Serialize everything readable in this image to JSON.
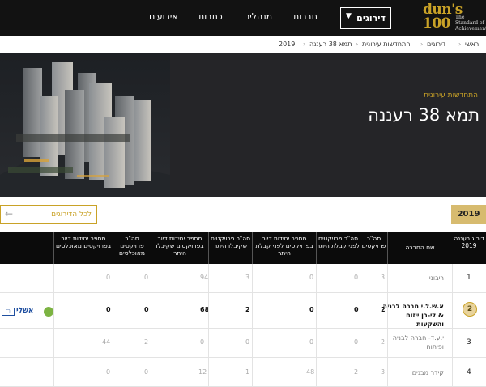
{
  "header": {
    "logo": {
      "main": "dun's 100",
      "tagline": "The Standard of Achievement"
    },
    "nav_dropdown": "דירוגים",
    "nav": [
      "חברות",
      "מנהלים",
      "כתבות",
      "אירועים"
    ]
  },
  "breadcrumb": [
    "ראשי",
    "דירוגים",
    "התחדשות עירונית",
    "תמא 38 רעננה",
    "2019"
  ],
  "hero": {
    "category": "התחדשות עירונית",
    "title": "תמא 38 רעננה"
  },
  "year_tab": "2019",
  "all_rankings_button": "לכל הדירוגים",
  "table": {
    "headers": [
      "דירוג רעננה 2019",
      "שם החברה",
      "סה\"כ פרויקטים",
      "סה\"כ פרויקטים לפני קבלת היתר",
      "מספר יחידות דיור בפרויקטים לפני קבלת היתר",
      "סה\"כ פרויקטים שקיבלו היתר",
      "מספר יחידות דיור בפרויקטים שקיבלו היתר",
      "סה\"כ פרויקטים מאוכלסים",
      "מספר יחידות דיור בפרויקטים מאוכלסים"
    ],
    "rows": [
      {
        "rank": "1",
        "name": "ריבוני",
        "cols": [
          "3",
          "0",
          "0",
          "3",
          "94",
          "0",
          "0"
        ],
        "logo": ""
      },
      {
        "rank": "2",
        "name": "א.ש.ל.י חברה לבניה & לי-רן ייזום והשקעות",
        "cols": [
          "2",
          "0",
          "0",
          "2",
          "68",
          "0",
          "0"
        ],
        "logo": "אשלי"
      },
      {
        "rank": "3",
        "name": "י.ע.ד- חברה לבניה ופיתוח",
        "cols": [
          "2",
          "0",
          "0",
          "0",
          "0",
          "2",
          "44"
        ],
        "logo": ""
      },
      {
        "rank": "4",
        "name": "קידר מבנים",
        "cols": [
          "3",
          "2",
          "48",
          "1",
          "12",
          "0",
          "0"
        ],
        "logo": ""
      }
    ]
  },
  "colors": {
    "accent": "#c9a227",
    "header_bg": "#121212",
    "year_tab_bg": "#d7bb6f"
  }
}
